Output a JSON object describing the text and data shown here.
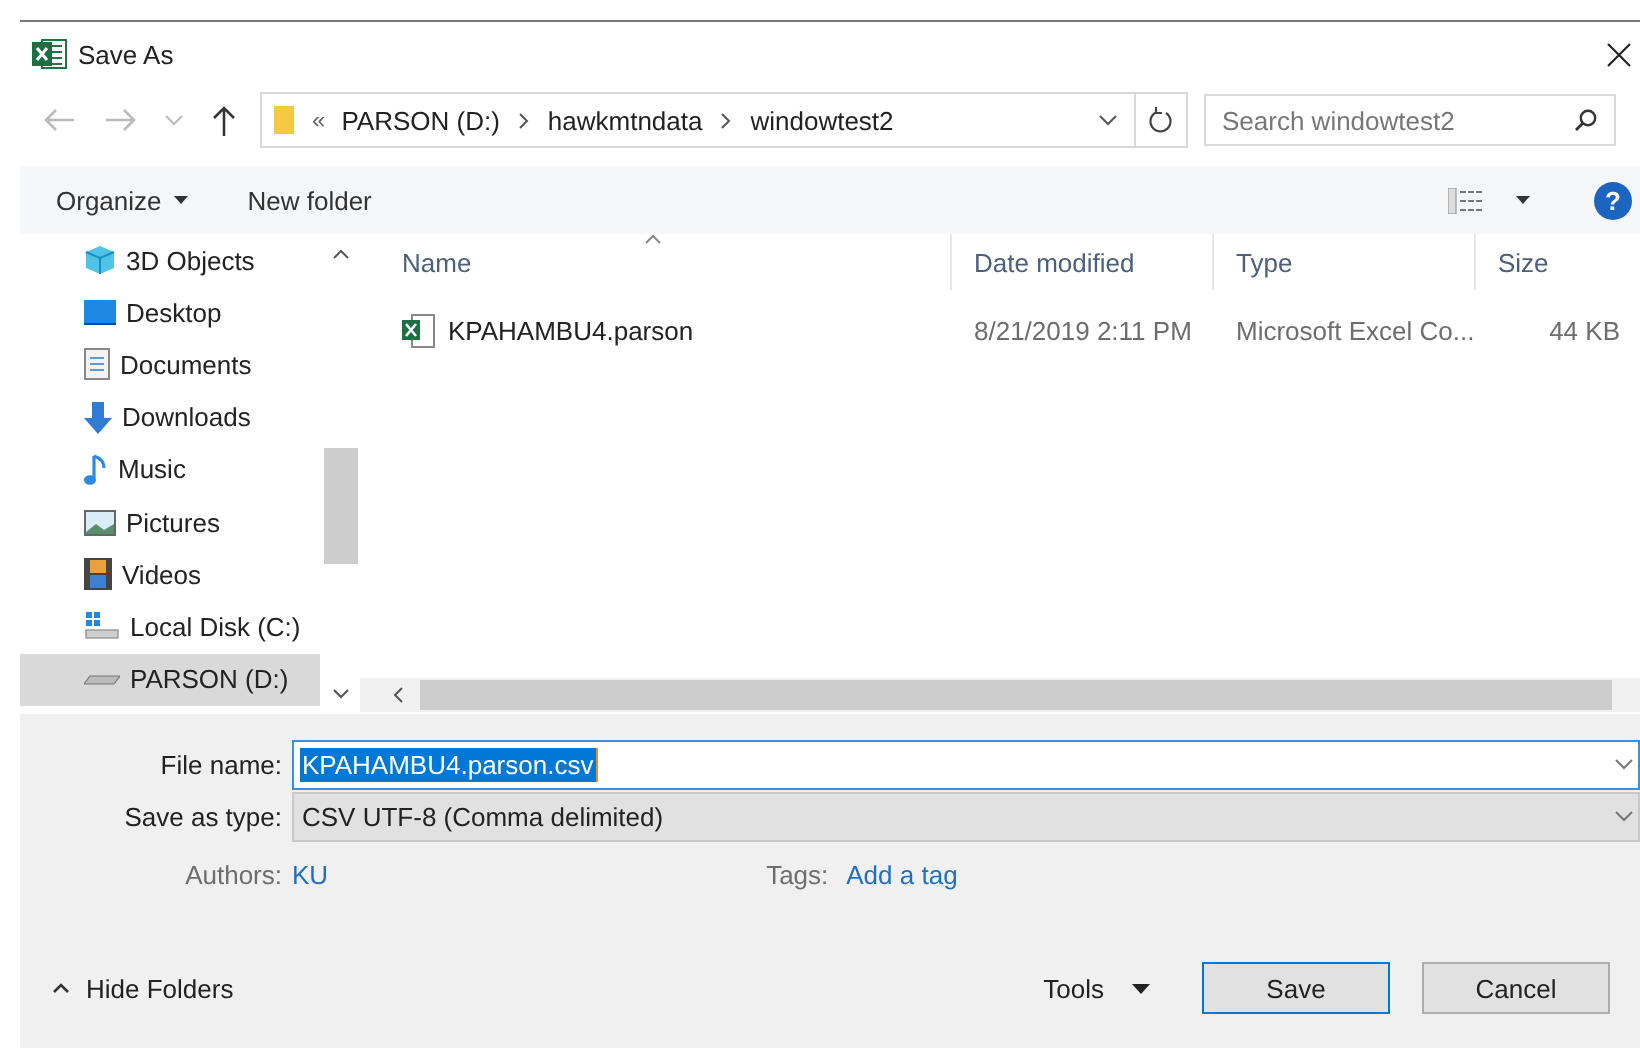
{
  "window": {
    "title": "Save As"
  },
  "address": {
    "overflow": "«",
    "path": [
      "PARSON (D:)",
      "hawkmtndata",
      "windowtest2"
    ]
  },
  "search": {
    "placeholder": "Search windowtest2"
  },
  "toolbar": {
    "organize": "Organize",
    "new_folder": "New folder",
    "help": "?"
  },
  "sidebar": {
    "items": [
      {
        "label": "3D Objects",
        "kind": "objects",
        "selected": false
      },
      {
        "label": "Desktop",
        "kind": "desktop",
        "selected": false
      },
      {
        "label": "Documents",
        "kind": "documents",
        "selected": false
      },
      {
        "label": "Downloads",
        "kind": "downloads",
        "selected": false
      },
      {
        "label": "Music",
        "kind": "music",
        "selected": false
      },
      {
        "label": "Pictures",
        "kind": "pictures",
        "selected": false
      },
      {
        "label": "Videos",
        "kind": "videos",
        "selected": false
      },
      {
        "label": "Local Disk (C:)",
        "kind": "systemdrive",
        "selected": false
      },
      {
        "label": "PARSON (D:)",
        "kind": "drive",
        "selected": true
      }
    ]
  },
  "table": {
    "columns": [
      "Name",
      "Date modified",
      "Type",
      "Size"
    ],
    "rows": [
      {
        "name": "KPAHAMBU4.parson",
        "date": "8/21/2019 2:11 PM",
        "type": "Microsoft Excel Co...",
        "size": "44 KB"
      }
    ]
  },
  "form": {
    "file_name_label": "File name:",
    "file_name": "KPAHAMBU4.parson.csv",
    "file_name_highlighted": true,
    "type_label": "Save as type:",
    "type": "CSV UTF-8 (Comma delimited)",
    "authors_label": "Authors:",
    "authors": "KU",
    "tags_label": "Tags:",
    "tags": "Add a tag"
  },
  "footer": {
    "hide_folders": "Hide Folders",
    "tools": "Tools",
    "save": "Save",
    "cancel": "Cancel"
  }
}
